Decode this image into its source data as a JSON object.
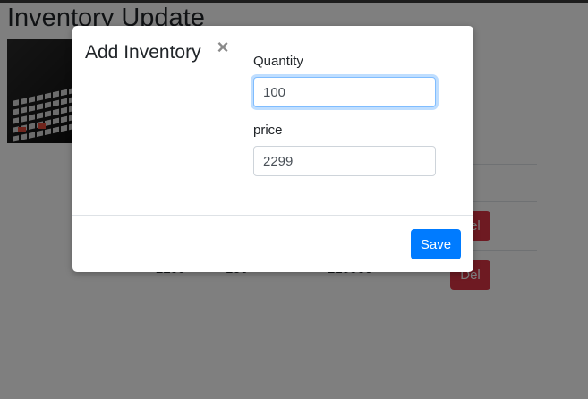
{
  "page": {
    "title": "Inventory Update"
  },
  "table": {
    "rows": [
      {
        "col1": "",
        "col2": "",
        "col3": "",
        "delete_label": "Del"
      },
      {
        "col1": "2299",
        "col2": "100",
        "col3": "229900",
        "delete_label": "Del"
      }
    ]
  },
  "modal": {
    "title": "Add Inventory",
    "close_symbol": "×",
    "quantity_label": "Quantity",
    "quantity_value": "100",
    "price_label": "price",
    "price_value": "2299",
    "save_label": "Save"
  },
  "colors": {
    "primary": "#007bff",
    "danger": "#dc3545",
    "backdrop": "rgba(0,0,0,0.5)"
  },
  "icons": {
    "close": "close-icon",
    "product_image": "laptop-keyboard-image"
  }
}
